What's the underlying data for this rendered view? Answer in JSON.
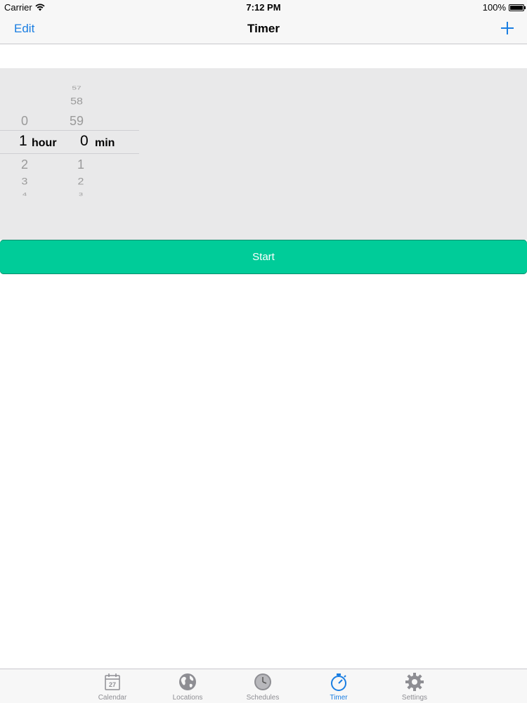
{
  "status_bar": {
    "carrier": "Carrier",
    "time": "7:12 PM",
    "battery": "100%"
  },
  "nav": {
    "edit_label": "Edit",
    "title": "Timer",
    "add_icon": "plus-icon"
  },
  "picker": {
    "hours": {
      "above": [
        "0"
      ],
      "selected": "1",
      "unit": "hour",
      "below": [
        "2",
        "3",
        "4"
      ]
    },
    "minutes": {
      "above": [
        "57",
        "58",
        "59"
      ],
      "selected": "0",
      "unit": "min",
      "below": [
        "1",
        "2",
        "3"
      ]
    }
  },
  "start_button": {
    "label": "Start",
    "color": "#00cc99"
  },
  "tab_bar": {
    "tabs": [
      {
        "label": "Calendar",
        "icon": "calendar-icon",
        "badge": "27"
      },
      {
        "label": "Locations",
        "icon": "globe-icon"
      },
      {
        "label": "Schedules",
        "icon": "clock-icon"
      },
      {
        "label": "Timer",
        "icon": "stopwatch-icon",
        "active": true
      },
      {
        "label": "Settings",
        "icon": "gear-icon"
      }
    ],
    "active_color": "#1a7ee2",
    "inactive_color": "#8e8e93"
  },
  "accent_color": "#1a7ee2"
}
